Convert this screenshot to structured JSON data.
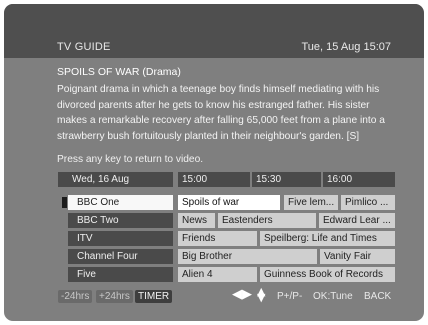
{
  "header": {
    "title": "TV GUIDE",
    "datetime": "Tue, 15 Aug  15:07"
  },
  "info": {
    "title": "SPOILS OF WAR  (Drama)",
    "description": "Poignant drama in which a teenage boy finds himself  mediating with his divorced parents after he gets to know his estranged father.   His sister makes a remarkable recovery after falling 65,000 feet from a plane into a strawberry bush fortuitously planted in their neighbour's garden. [S]",
    "hint": "Press any key to return to video."
  },
  "grid": {
    "date": "Wed, 16 Aug",
    "times": [
      "15:00",
      "15:30",
      "16:00"
    ],
    "channels": [
      {
        "name": "BBC One",
        "selected": true,
        "programs": [
          "Spoils of war",
          "Five lem...",
          "Pimlico ..."
        ]
      },
      {
        "name": "BBC Two",
        "programs": [
          "News",
          "Eastenders",
          "Edward Lear ..."
        ]
      },
      {
        "name": "ITV",
        "programs": [
          "Friends",
          "Speilberg:  Life and Times"
        ]
      },
      {
        "name": "Channel Four",
        "programs": [
          "Big Brother",
          "Vanity Fair"
        ]
      },
      {
        "name": "Five",
        "programs": [
          "Alien 4",
          "Guinness Book of Records"
        ]
      }
    ]
  },
  "footer": {
    "minus24": "-24hrs",
    "plus24": "+24hrs",
    "timer": "TIMER",
    "leftright_icon": "left-right-arrows-icon",
    "updown_icon": "up-down-arrows-icon",
    "page": "P+/P-",
    "ok": "OK:Tune",
    "back": "BACK"
  },
  "colors": {
    "background": "#7f7f7f",
    "header_band": "#4f4f4f",
    "program_cell": "#cfcfcf",
    "selected": "#ffffff"
  }
}
